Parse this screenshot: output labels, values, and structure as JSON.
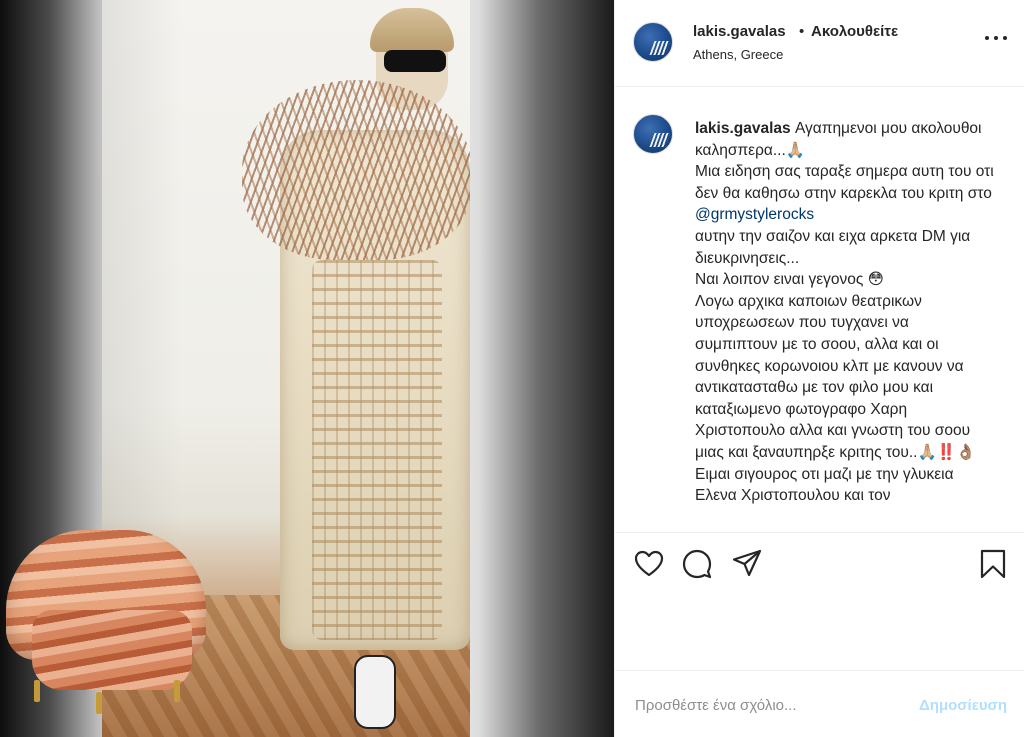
{
  "post": {
    "username": "lakis.gavalas",
    "separator": "•",
    "follow_status": "Ακολουθείτε",
    "location": "Athens, Greece"
  },
  "caption": {
    "username": "lakis.gavalas",
    "text_before_mention": " Αγαπημενοι μου ακολουθοι καλησπερα...🙏🏼\nΜια ειδηση σας ταραξε σημερα αυτη του οτι δεν θα καθησω στην καρεκλα του κριτη στο ",
    "mention": "@grmystylerocks",
    "text_after_mention": "\nαυτην την σαιζον και ειχα αρκετα DM για διευκρινησεις...\nΝαι λοιπον ειναι γεγονος 😳\nΛογω αρχικα καποιων θεατρικων υποχρεωσεων που τυγχανει να συμπιπτουν με το σοου, αλλα και οι συνθηκες κορωνοιου κλπ με κανουν να αντικατασταθω με τον φιλο μου και καταξιωμενο φωτογραφο Χαρη Χριστοπουλο αλλα και γνωστη του σοου μιας και ξαναυπηρξε κριτης του..🙏🏼‼️👌🏽\nΕιμαι σιγουρος οτι μαζι με την γλυκεια Ελενα Χριστοπουλου και τον"
  },
  "comment": {
    "placeholder": "Προσθέστε ένα σχόλιο...",
    "publish_label": "Δημοσίευση"
  },
  "icons": {
    "like": "heart-icon",
    "comment": "comment-icon",
    "share": "paper-plane-icon",
    "save": "bookmark-icon",
    "more": "more-options-icon"
  },
  "colors": {
    "text": "#262626",
    "secondary_text": "#8e8e8e",
    "link": "#00376b",
    "publish_disabled": "#b2dffc",
    "border": "#efefef"
  }
}
